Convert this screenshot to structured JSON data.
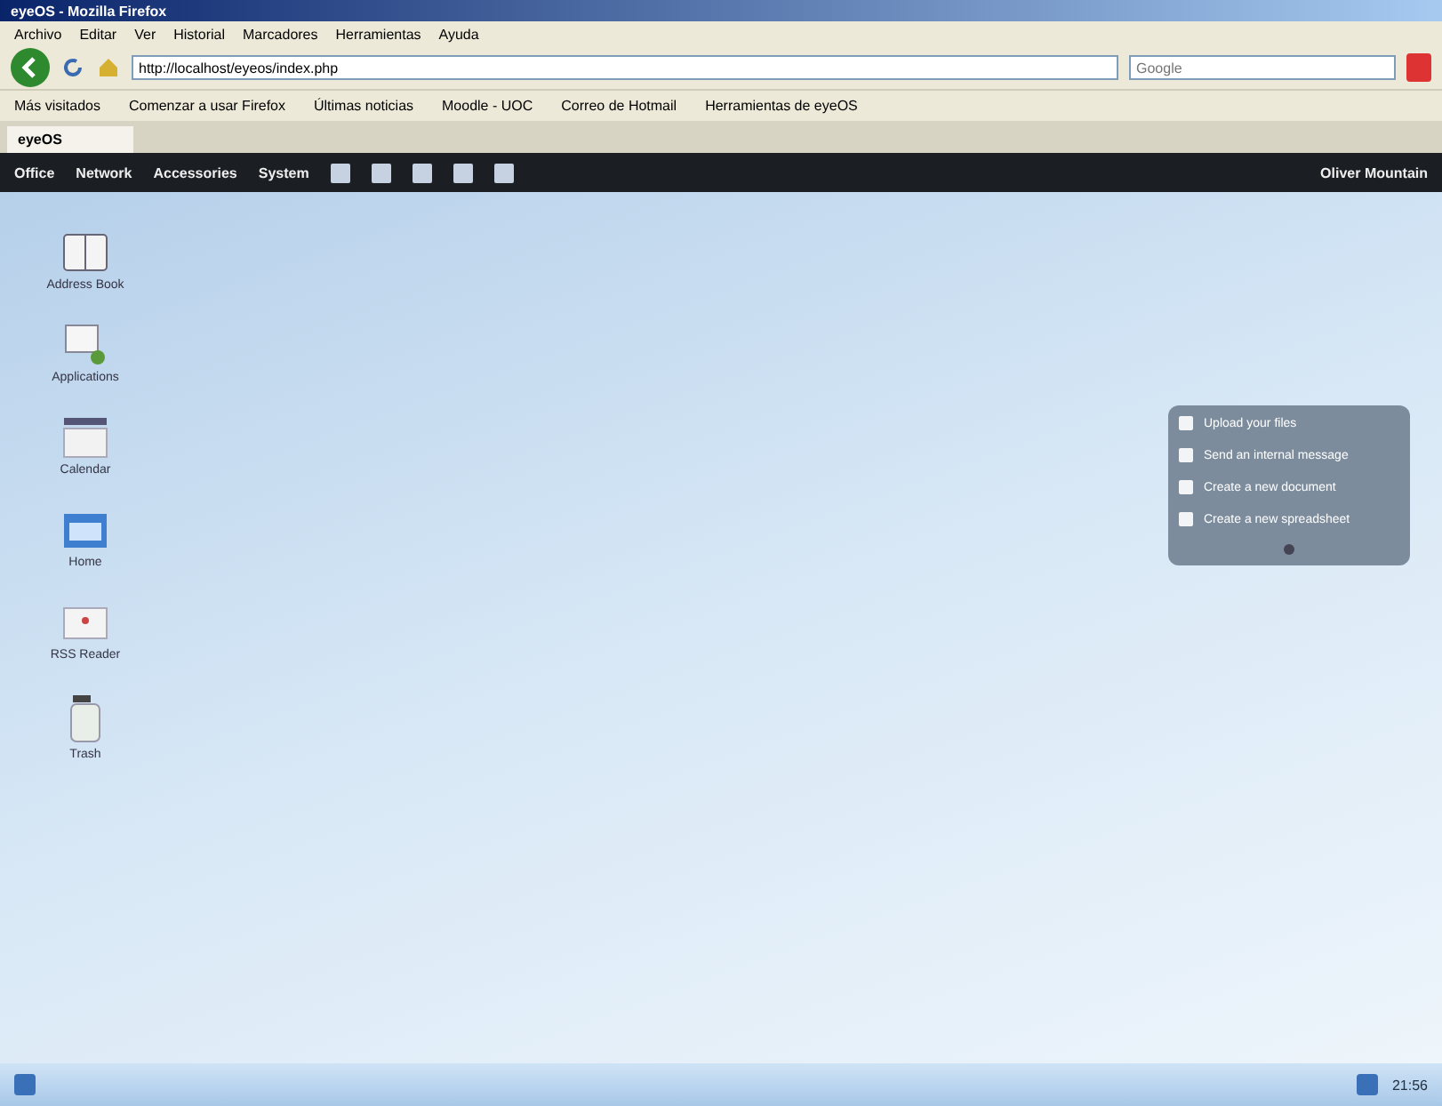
{
  "window": {
    "title": "eyeOS - Mozilla Firefox"
  },
  "menu": [
    "Archivo",
    "Editar",
    "Ver",
    "Historial",
    "Marcadores",
    "Herramientas",
    "Ayuda"
  ],
  "address_bar": {
    "value": "http://localhost/eyeos/index.php"
  },
  "search": {
    "placeholder": "Google"
  },
  "bookmarks": [
    "Más visitados",
    "Comenzar a usar Firefox",
    "Últimas noticias",
    "Moodle - UOC",
    "Correo de Hotmail",
    "Herramientas de eyeOS"
  ],
  "tabs": [
    {
      "label": "eyeOS",
      "selected": true
    }
  ],
  "top_bar": {
    "menus": [
      "Office",
      "Network",
      "Accessories",
      "System"
    ],
    "user": "Oliver Mountain"
  },
  "desktop_icons": [
    {
      "label": "Address Book",
      "kind": "book"
    },
    {
      "label": "Applications",
      "kind": "apps"
    },
    {
      "label": "Calendar",
      "kind": "calendar"
    },
    {
      "label": "Home",
      "kind": "folder"
    },
    {
      "label": "RSS Reader",
      "kind": "rss"
    },
    {
      "label": "Trash",
      "kind": "trash"
    }
  ],
  "widget": {
    "items": [
      "Upload your files",
      "Send an internal message",
      "Create a new document",
      "Create a new spreadsheet"
    ]
  },
  "taskbar": {
    "clock": "21:56"
  }
}
